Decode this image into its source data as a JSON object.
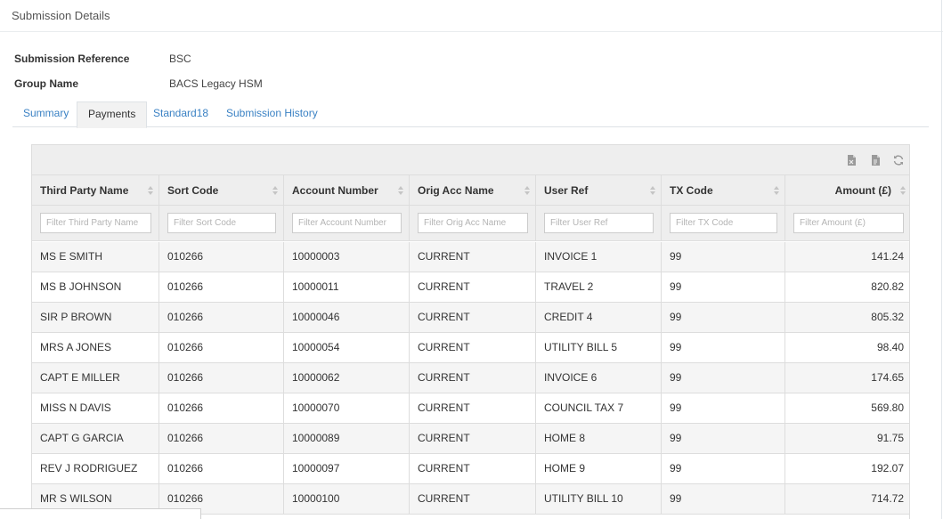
{
  "page": {
    "title": "Submission Details"
  },
  "fields": [
    {
      "label": "Submission Reference",
      "value": "BSC"
    },
    {
      "label": "Group Name",
      "value": "BACS Legacy HSM"
    }
  ],
  "tabs": [
    "Summary",
    "Payments",
    "Standard18",
    "Submission History"
  ],
  "active_tab": "Payments",
  "toolbar": {
    "icons": [
      "export-excel-icon",
      "export-csv-icon",
      "refresh-icon"
    ]
  },
  "table": {
    "columns": [
      "Third Party Name",
      "Sort Code",
      "Account Number",
      "Orig Acc Name",
      "User Ref",
      "TX Code",
      "Amount (£)"
    ],
    "filters": [
      "Filter Third Party Name",
      "Filter Sort Code",
      "Filter Account Number",
      "Filter Orig Acc Name",
      "Filter User Ref",
      "Filter TX Code",
      "Filter Amount (£)"
    ],
    "rows": [
      [
        "MS E SMITH",
        "010266",
        "10000003",
        "CURRENT",
        "INVOICE 1",
        "99",
        "141.24"
      ],
      [
        "MS B JOHNSON",
        "010266",
        "10000011",
        "CURRENT",
        "TRAVEL 2",
        "99",
        "820.82"
      ],
      [
        "SIR P BROWN",
        "010266",
        "10000046",
        "CURRENT",
        "CREDIT 4",
        "99",
        "805.32"
      ],
      [
        "MRS A JONES",
        "010266",
        "10000054",
        "CURRENT",
        "UTILITY BILL 5",
        "99",
        "98.40"
      ],
      [
        "CAPT E MILLER",
        "010266",
        "10000062",
        "CURRENT",
        "INVOICE 6",
        "99",
        "174.65"
      ],
      [
        "MISS N DAVIS",
        "010266",
        "10000070",
        "CURRENT",
        "COUNCIL TAX 7",
        "99",
        "569.80"
      ],
      [
        "CAPT G GARCIA",
        "010266",
        "10000089",
        "CURRENT",
        "HOME 8",
        "99",
        "91.75"
      ],
      [
        "REV J RODRIGUEZ",
        "010266",
        "10000097",
        "CURRENT",
        "HOME 9",
        "99",
        "192.07"
      ],
      [
        "MR S WILSON",
        "010266",
        "10000100",
        "CURRENT",
        "UTILITY BILL 10",
        "99",
        "714.72"
      ]
    ]
  },
  "colors": {
    "link": "#3b82c4",
    "header_bg": "#eeeeee",
    "stripe": "#f5f5f5",
    "border": "#dddddd"
  }
}
